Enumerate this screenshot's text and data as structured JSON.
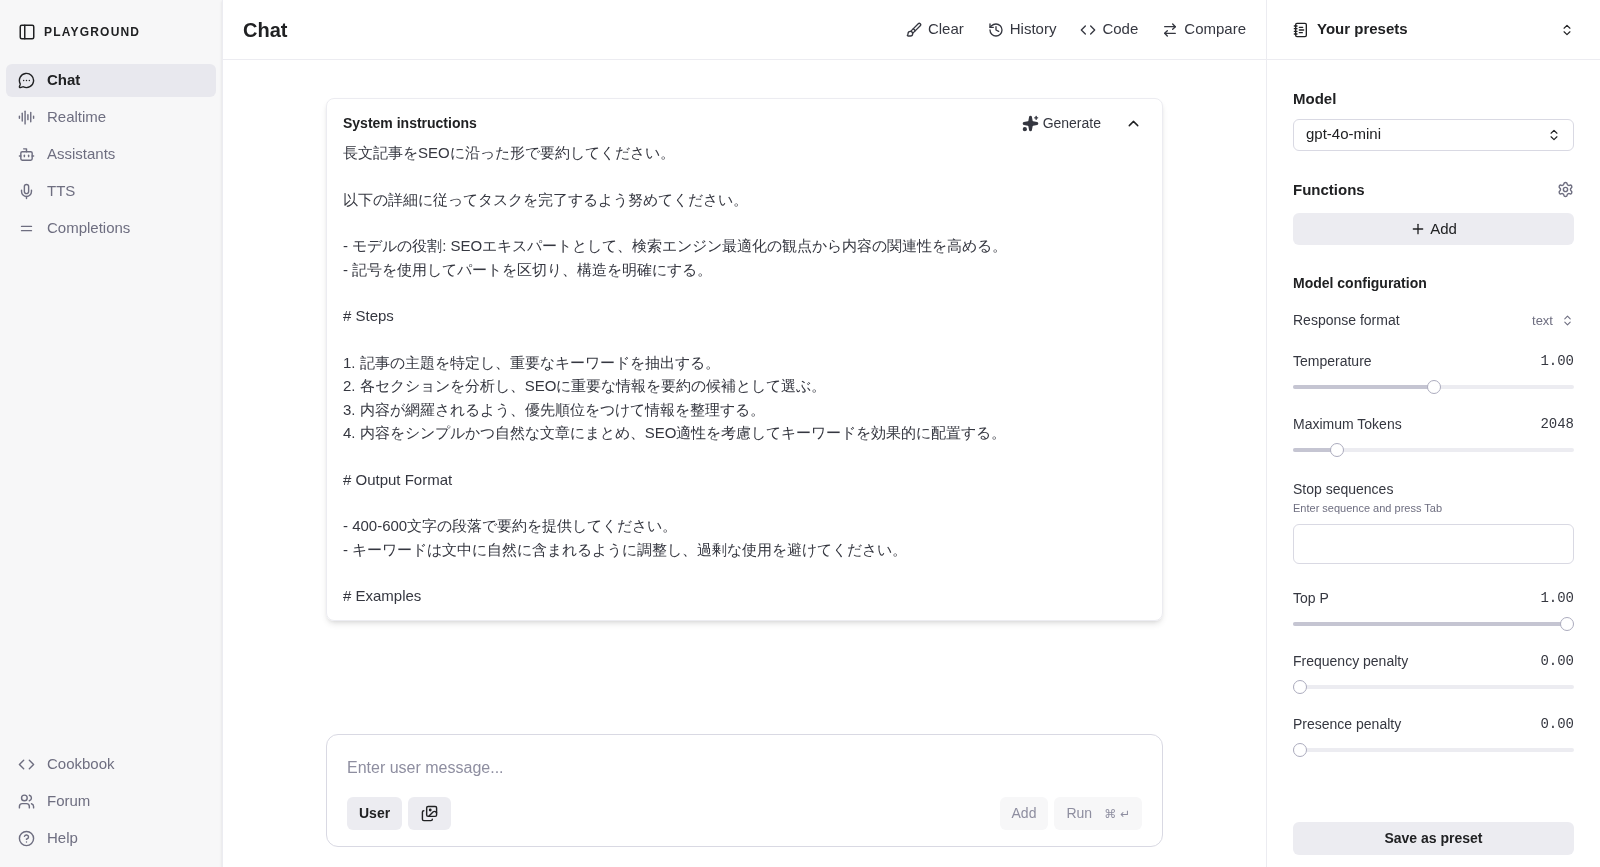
{
  "sidebar": {
    "title": "PLAYGROUND",
    "nav": [
      {
        "label": "Chat",
        "selected": true
      },
      {
        "label": "Realtime",
        "selected": false
      },
      {
        "label": "Assistants",
        "selected": false
      },
      {
        "label": "TTS",
        "selected": false
      },
      {
        "label": "Completions",
        "selected": false
      }
    ],
    "footer": [
      {
        "label": "Cookbook"
      },
      {
        "label": "Forum"
      },
      {
        "label": "Help"
      }
    ]
  },
  "header": {
    "title": "Chat",
    "actions": [
      {
        "label": "Clear"
      },
      {
        "label": "History"
      },
      {
        "label": "Code"
      },
      {
        "label": "Compare"
      }
    ]
  },
  "system_instructions": {
    "title": "System instructions",
    "generate": "Generate",
    "expanded": true,
    "paragraphs": [
      [
        "長文記事をSEOに沿った形で要約してください。"
      ],
      [
        "以下の詳細に従ってタスクを完了するよう努めてください。"
      ],
      [
        "- モデルの役割: SEOエキスパートとして、検索エンジン最適化の観点から内容の関連性を高める。",
        "- 記号を使用してパートを区切り、構造を明確にする。"
      ],
      [
        "# Steps"
      ],
      [
        "1. 記事の主題を特定し、重要なキーワードを抽出する。",
        "2. 各セクションを分析し、SEOに重要な情報を要約の候補として選ぶ。",
        "3. 内容が網羅されるよう、優先順位をつけて情報を整理する。",
        "4. 内容をシンプルかつ自然な文章にまとめ、SEO適性を考慮してキーワードを効果的に配置する。"
      ],
      [
        "# Output Format"
      ],
      [
        "- 400-600文字の段落で要約を提供してください。",
        "- キーワードは文中に自然に含まれるように調整し、過剰な使用を避けてください。"
      ],
      [
        "# Examples"
      ]
    ]
  },
  "composer": {
    "placeholder": "Enter user message...",
    "role": "User",
    "add": "Add",
    "run": "Run",
    "shortcut": "⌘ ↵"
  },
  "settings": {
    "presets": "Your presets",
    "model_label": "Model",
    "model": "gpt-4o-mini",
    "functions_label": "Functions",
    "add_function": "Add",
    "config_label": "Model configuration",
    "response_format_label": "Response format",
    "response_format": "text",
    "sliders": [
      {
        "label": "Temperature",
        "reading": "1.00",
        "level": 0.5
      },
      {
        "label": "Maximum Tokens",
        "reading": "2048",
        "level": 0.14
      }
    ],
    "stop_label": "Stop sequences",
    "stop_hint": "Enter sequence and press Tab",
    "sliders_2": [
      {
        "label": "Top P",
        "reading": "1.00",
        "level": 1
      },
      {
        "label": "Frequency penalty",
        "reading": "0.00",
        "level": 0
      },
      {
        "label": "Presence penalty",
        "reading": "0.00",
        "level": 0
      }
    ],
    "save": "Save as preset"
  }
}
